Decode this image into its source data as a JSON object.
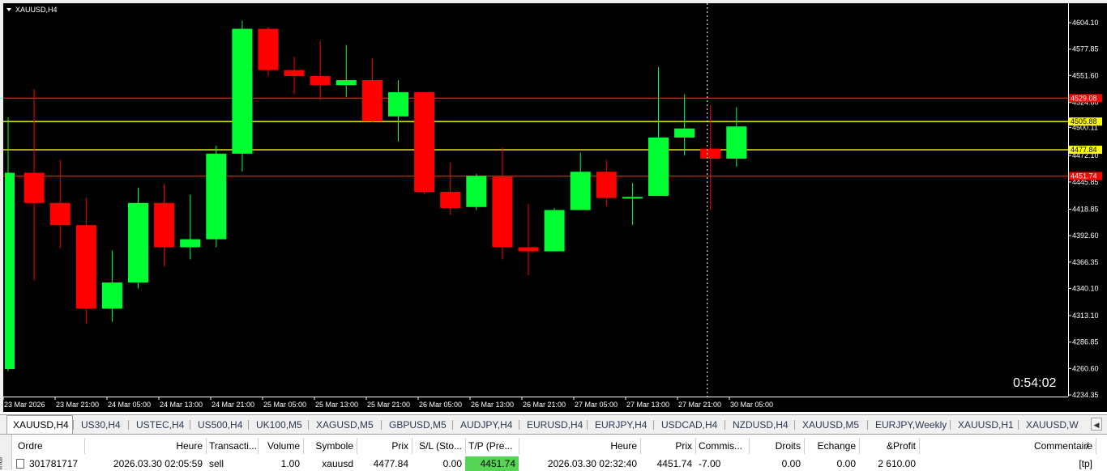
{
  "chart": {
    "symbol_label": "XAUUSD,H4",
    "countdown": "0:54:02",
    "colors": {
      "background": "#000000",
      "bull": "#00ff33",
      "bear": "#ff0000",
      "axis_text": "#ffffff",
      "hline_red": "#ff0000",
      "hline_yellow": "#ffff00"
    },
    "price_labels": [
      "4604.10",
      "4577.85",
      "4551.60",
      "4524.80",
      "4500.11",
      "4472.10",
      "4445.85",
      "4418.85",
      "4392.60",
      "4366.35",
      "4340.10",
      "4313.10",
      "4286.85",
      "4260.60",
      "4234.35"
    ],
    "time_labels": [
      "23 Mar 2026",
      "23 Mar 21:00",
      "24 Mar 05:00",
      "24 Mar 13:00",
      "24 Mar 21:00",
      "25 Mar 05:00",
      "25 Mar 13:00",
      "25 Mar 21:00",
      "26 Mar 05:00",
      "26 Mar 13:00",
      "26 Mar 21:00",
      "27 Mar 05:00",
      "27 Mar 13:00",
      "27 Mar 21:00",
      "30 Mar 05:00"
    ],
    "levels": [
      {
        "price": 4529.08,
        "label": "4529.08",
        "kind": "red"
      },
      {
        "price": 4505.88,
        "label": "4505.88",
        "kind": "yellow"
      },
      {
        "price": 4477.84,
        "label": "4477.84",
        "kind": "yellow"
      },
      {
        "price": 4451.74,
        "label": "4451.74",
        "kind": "red"
      }
    ],
    "crosshair_time": "27 Mar 21:00"
  },
  "chart_data": {
    "type": "candlestick",
    "title": "XAUUSD,H4",
    "ylim": [
      4234.35,
      4604.1
    ],
    "candles": [
      {
        "o": 4260,
        "h": 4510,
        "l": 4258,
        "c": 4455
      },
      {
        "o": 4455,
        "h": 4538,
        "l": 4348,
        "c": 4425
      },
      {
        "o": 4425,
        "h": 4468,
        "l": 4380,
        "c": 4403
      },
      {
        "o": 4403,
        "h": 4430,
        "l": 4305,
        "c": 4320
      },
      {
        "o": 4320,
        "h": 4378,
        "l": 4307,
        "c": 4346
      },
      {
        "o": 4346,
        "h": 4440,
        "l": 4340,
        "c": 4425
      },
      {
        "o": 4425,
        "h": 4444,
        "l": 4362,
        "c": 4381
      },
      {
        "o": 4381,
        "h": 4433,
        "l": 4369,
        "c": 4389
      },
      {
        "o": 4389,
        "h": 4482,
        "l": 4381,
        "c": 4474
      },
      {
        "o": 4474,
        "h": 4606,
        "l": 4456,
        "c": 4598
      },
      {
        "o": 4598,
        "h": 4600,
        "l": 4551,
        "c": 4557
      },
      {
        "o": 4557,
        "h": 4570,
        "l": 4533,
        "c": 4551
      },
      {
        "o": 4551,
        "h": 4586,
        "l": 4527,
        "c": 4542
      },
      {
        "o": 4542,
        "h": 4582,
        "l": 4530,
        "c": 4547
      },
      {
        "o": 4547,
        "h": 4569,
        "l": 4505,
        "c": 4506
      },
      {
        "o": 4511,
        "h": 4547,
        "l": 4486,
        "c": 4535
      },
      {
        "o": 4535,
        "h": 4535,
        "l": 4434,
        "c": 4436
      },
      {
        "o": 4436,
        "h": 4465,
        "l": 4413,
        "c": 4420
      },
      {
        "o": 4421,
        "h": 4454,
        "l": 4418,
        "c": 4452
      },
      {
        "o": 4451,
        "h": 4480,
        "l": 4369,
        "c": 4381
      },
      {
        "o": 4381,
        "h": 4424,
        "l": 4353,
        "c": 4377
      },
      {
        "o": 4377,
        "h": 4420,
        "l": 4377,
        "c": 4418
      },
      {
        "o": 4418,
        "h": 4475,
        "l": 4418,
        "c": 4456
      },
      {
        "o": 4456,
        "h": 4468,
        "l": 4422,
        "c": 4430
      },
      {
        "o": 4430,
        "h": 4445,
        "l": 4403,
        "c": 4431
      },
      {
        "o": 4432,
        "h": 4560,
        "l": 4432,
        "c": 4490
      },
      {
        "o": 4490,
        "h": 4533,
        "l": 4472,
        "c": 4499
      },
      {
        "o": 4479,
        "h": 4522,
        "l": 4418,
        "c": 4469
      },
      {
        "o": 4469,
        "h": 4520,
        "l": 4461,
        "c": 4501
      }
    ]
  },
  "tabs": [
    {
      "label": "XAUUSD,H4",
      "active": true
    },
    {
      "label": "US30,H4"
    },
    {
      "label": "USTEC,H4"
    },
    {
      "label": "US500,H4"
    },
    {
      "label": "UK100,M5"
    },
    {
      "label": "XAGUSD,M5"
    },
    {
      "label": "GBPUSD,M5"
    },
    {
      "label": "AUDJPY,H4"
    },
    {
      "label": "EURUSD,H4"
    },
    {
      "label": "EURJPY,H4"
    },
    {
      "label": "USDCAD,H4"
    },
    {
      "label": "NZDUSD,H4"
    },
    {
      "label": "XAUUSD,M5"
    },
    {
      "label": "EURJPY,Weekly"
    },
    {
      "label": "XAUUSD,H1"
    },
    {
      "label": "XAUUSD,W"
    }
  ],
  "terminal": {
    "side_label": "inal",
    "columns": [
      "Ordre",
      "Heure",
      "Transacti...",
      "Volume",
      "Symbole",
      "Prix",
      "S/L (Sto...",
      "T/P (Pre...",
      "Heure",
      "Prix",
      "Commis...",
      "Droits",
      "Echange",
      "&Profit",
      "Commentaire"
    ],
    "sort_glyph": "/",
    "row": [
      "301781717",
      "2026.03.30 02:05:59",
      "sell",
      "1.00",
      "xauusd",
      "4477.84",
      "0.00",
      "4451.74",
      "2026.03.30 02:32:40",
      "4451.74",
      "-7.00",
      "0.00",
      "0.00",
      "2 610.00",
      "[tp]"
    ]
  }
}
